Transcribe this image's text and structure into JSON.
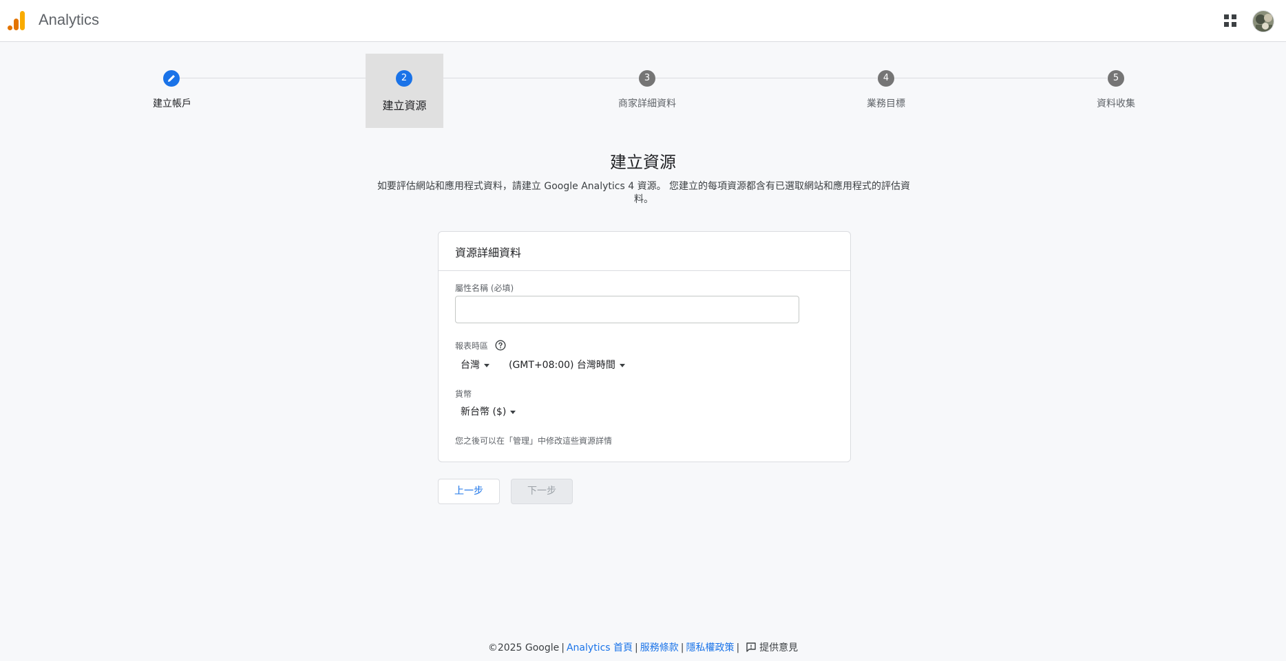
{
  "header": {
    "app_title": "Analytics",
    "logo_icon": "analytics-logo-icon",
    "apps_icon": "apps-grid-icon",
    "avatar_icon": "user-avatar"
  },
  "stepper": {
    "steps": [
      {
        "number": "",
        "label": "建立帳戶",
        "state": "done",
        "icon": "pencil-icon"
      },
      {
        "number": "2",
        "label": "建立資源",
        "state": "current"
      },
      {
        "number": "3",
        "label": "商家詳細資料",
        "state": "pending"
      },
      {
        "number": "4",
        "label": "業務目標",
        "state": "pending"
      },
      {
        "number": "5",
        "label": "資料收集",
        "state": "pending"
      }
    ]
  },
  "main": {
    "title": "建立資源",
    "description_line1": "如要評估網站和應用程式資料，請建立 Google Analytics 4 資源。 您建立的每項資源都含有已選取網站和應用程式的評估資",
    "description_line2": "料。"
  },
  "card": {
    "header": "資源詳細資料",
    "property_name_label": "屬性名稱 (必填)",
    "property_name_value": "",
    "timezone_label": "報表時區",
    "country_value": "台灣",
    "timezone_value": "(GMT+08:00) 台灣時間",
    "currency_label": "貨幣",
    "currency_value": "新台幣 ($)",
    "note": "您之後可以在「管理」中修改這些資源詳情"
  },
  "actions": {
    "back_label": "上一步",
    "next_label": "下一步"
  },
  "footer": {
    "copyright": "©2025 Google",
    "home_link": "Analytics 首頁",
    "terms_link": "服務條款",
    "privacy_link": "隱私權政策",
    "feedback_label": "提供意見"
  },
  "colors": {
    "accent": "#1a73e8",
    "pending_step": "#757575",
    "logo_orange": "#f9ab00",
    "logo_dark_orange": "#e37400"
  }
}
